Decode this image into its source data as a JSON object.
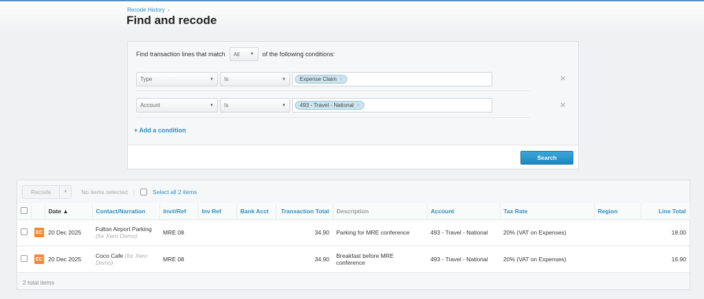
{
  "header": {
    "breadcrumb": "Recode History",
    "breadcrumb_sep": "›",
    "title": "Find and recode"
  },
  "filter": {
    "prefix": "Find transaction lines that match",
    "match_value": "All",
    "suffix": "of the following conditions:",
    "conditions": [
      {
        "field": "Type",
        "operator": "Is",
        "value": "Expense Claim"
      },
      {
        "field": "Account",
        "operator": "Is",
        "value": "493 - Travel - National"
      }
    ],
    "add_condition": "+ Add a condition",
    "search_label": "Search"
  },
  "results": {
    "recode_label": "Recode",
    "selection_status": "No items selected",
    "select_all": "Select all 2 items",
    "columns": [
      "Date ▲",
      "Contact/Narration",
      "Inv#/Ref",
      "Inv Ref",
      "Bank Acct",
      "Transaction Total",
      "Description",
      "Account",
      "Tax Rate",
      "Region",
      "Line Total"
    ],
    "rows": [
      {
        "badge": "EC",
        "date": "20 Dec 2025",
        "contact": "Fulton Airport Parking",
        "note": "(for Xero Demo)",
        "inv_ref": "MRE 08",
        "inv_ref2": "",
        "bank_acct": "",
        "transaction_total": "34.90",
        "description": "Parking for MRE conference",
        "account": "493 - Travel - National",
        "tax_rate": "20% (VAT on Expenses)",
        "region": "",
        "line_total": "18.00"
      },
      {
        "badge": "EC",
        "date": "20 Dec 2025",
        "contact": "Coco Cafe",
        "note": "(for Xero Demo)",
        "inv_ref": "MRE 08",
        "inv_ref2": "",
        "bank_acct": "",
        "transaction_total": "34.90",
        "description": "Breakfast before MRE conference",
        "account": "493 - Travel - National",
        "tax_rate": "20% (VAT on Expenses)",
        "region": "",
        "line_total": "16.90"
      }
    ],
    "total_items": "2 total items"
  },
  "colors": {
    "accent": "#2a8fbd",
    "badge": "#f08a3a"
  }
}
